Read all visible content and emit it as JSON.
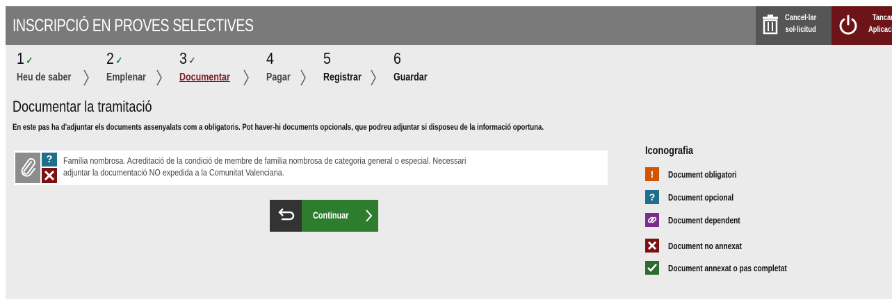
{
  "header": {
    "title": "INSCRIPCIÓ EN PROVES SELECTIVES",
    "cancel_line1": "Cancel·lar",
    "cancel_line2": "sol·licitud",
    "close_line1": "Tancar",
    "close_line2": "Aplicació"
  },
  "steps": [
    {
      "number": "1",
      "label": "Heu de saber",
      "done": true
    },
    {
      "number": "2",
      "label": "Emplenar",
      "done": true
    },
    {
      "number": "3",
      "label": "Documentar",
      "done": true,
      "current": true
    },
    {
      "number": "4",
      "label": "Pagar",
      "done": false
    },
    {
      "number": "5",
      "label": "Registrar",
      "done": false
    },
    {
      "number": "6",
      "label": "Guardar",
      "done": false
    }
  ],
  "page": {
    "title": "Documentar la tramitació",
    "description": "En este pas ha d'adjuntar els documents assenyalats com a obligatoris. Pot haver-hi documents opcionals, que podreu adjuntar si disposeu de la informació oportuna."
  },
  "document": {
    "type_symbol": "?",
    "text_line1": "Família nombrosa. Acreditació de la condició de membre de família nombrosa de categoria general o especial. Necessari",
    "text_line2": "adjuntar la documentació NO expedida a la Comunitat Valenciana."
  },
  "actions": {
    "continue_label": "Continuar"
  },
  "legend": {
    "title": "Iconografia",
    "items": [
      {
        "symbol": "!",
        "label": "Document obligatori",
        "color": "#d35400"
      },
      {
        "symbol": "?",
        "label": "Document opcional",
        "color": "#1e6f8a"
      },
      {
        "symbol": "link",
        "label": "Document dependent",
        "color": "#7b2d8e"
      },
      {
        "symbol": "x",
        "label": "Document no annexat",
        "color": "#7d1111"
      },
      {
        "symbol": "check",
        "label": "Document annexat o pas completat",
        "color": "#2e6b2e"
      }
    ]
  },
  "colors": {
    "header_bg": "#7a7a7a",
    "accent_red": "#6d1418",
    "continue_green": "#2e7d2e",
    "current_step": "#7b1d22"
  }
}
